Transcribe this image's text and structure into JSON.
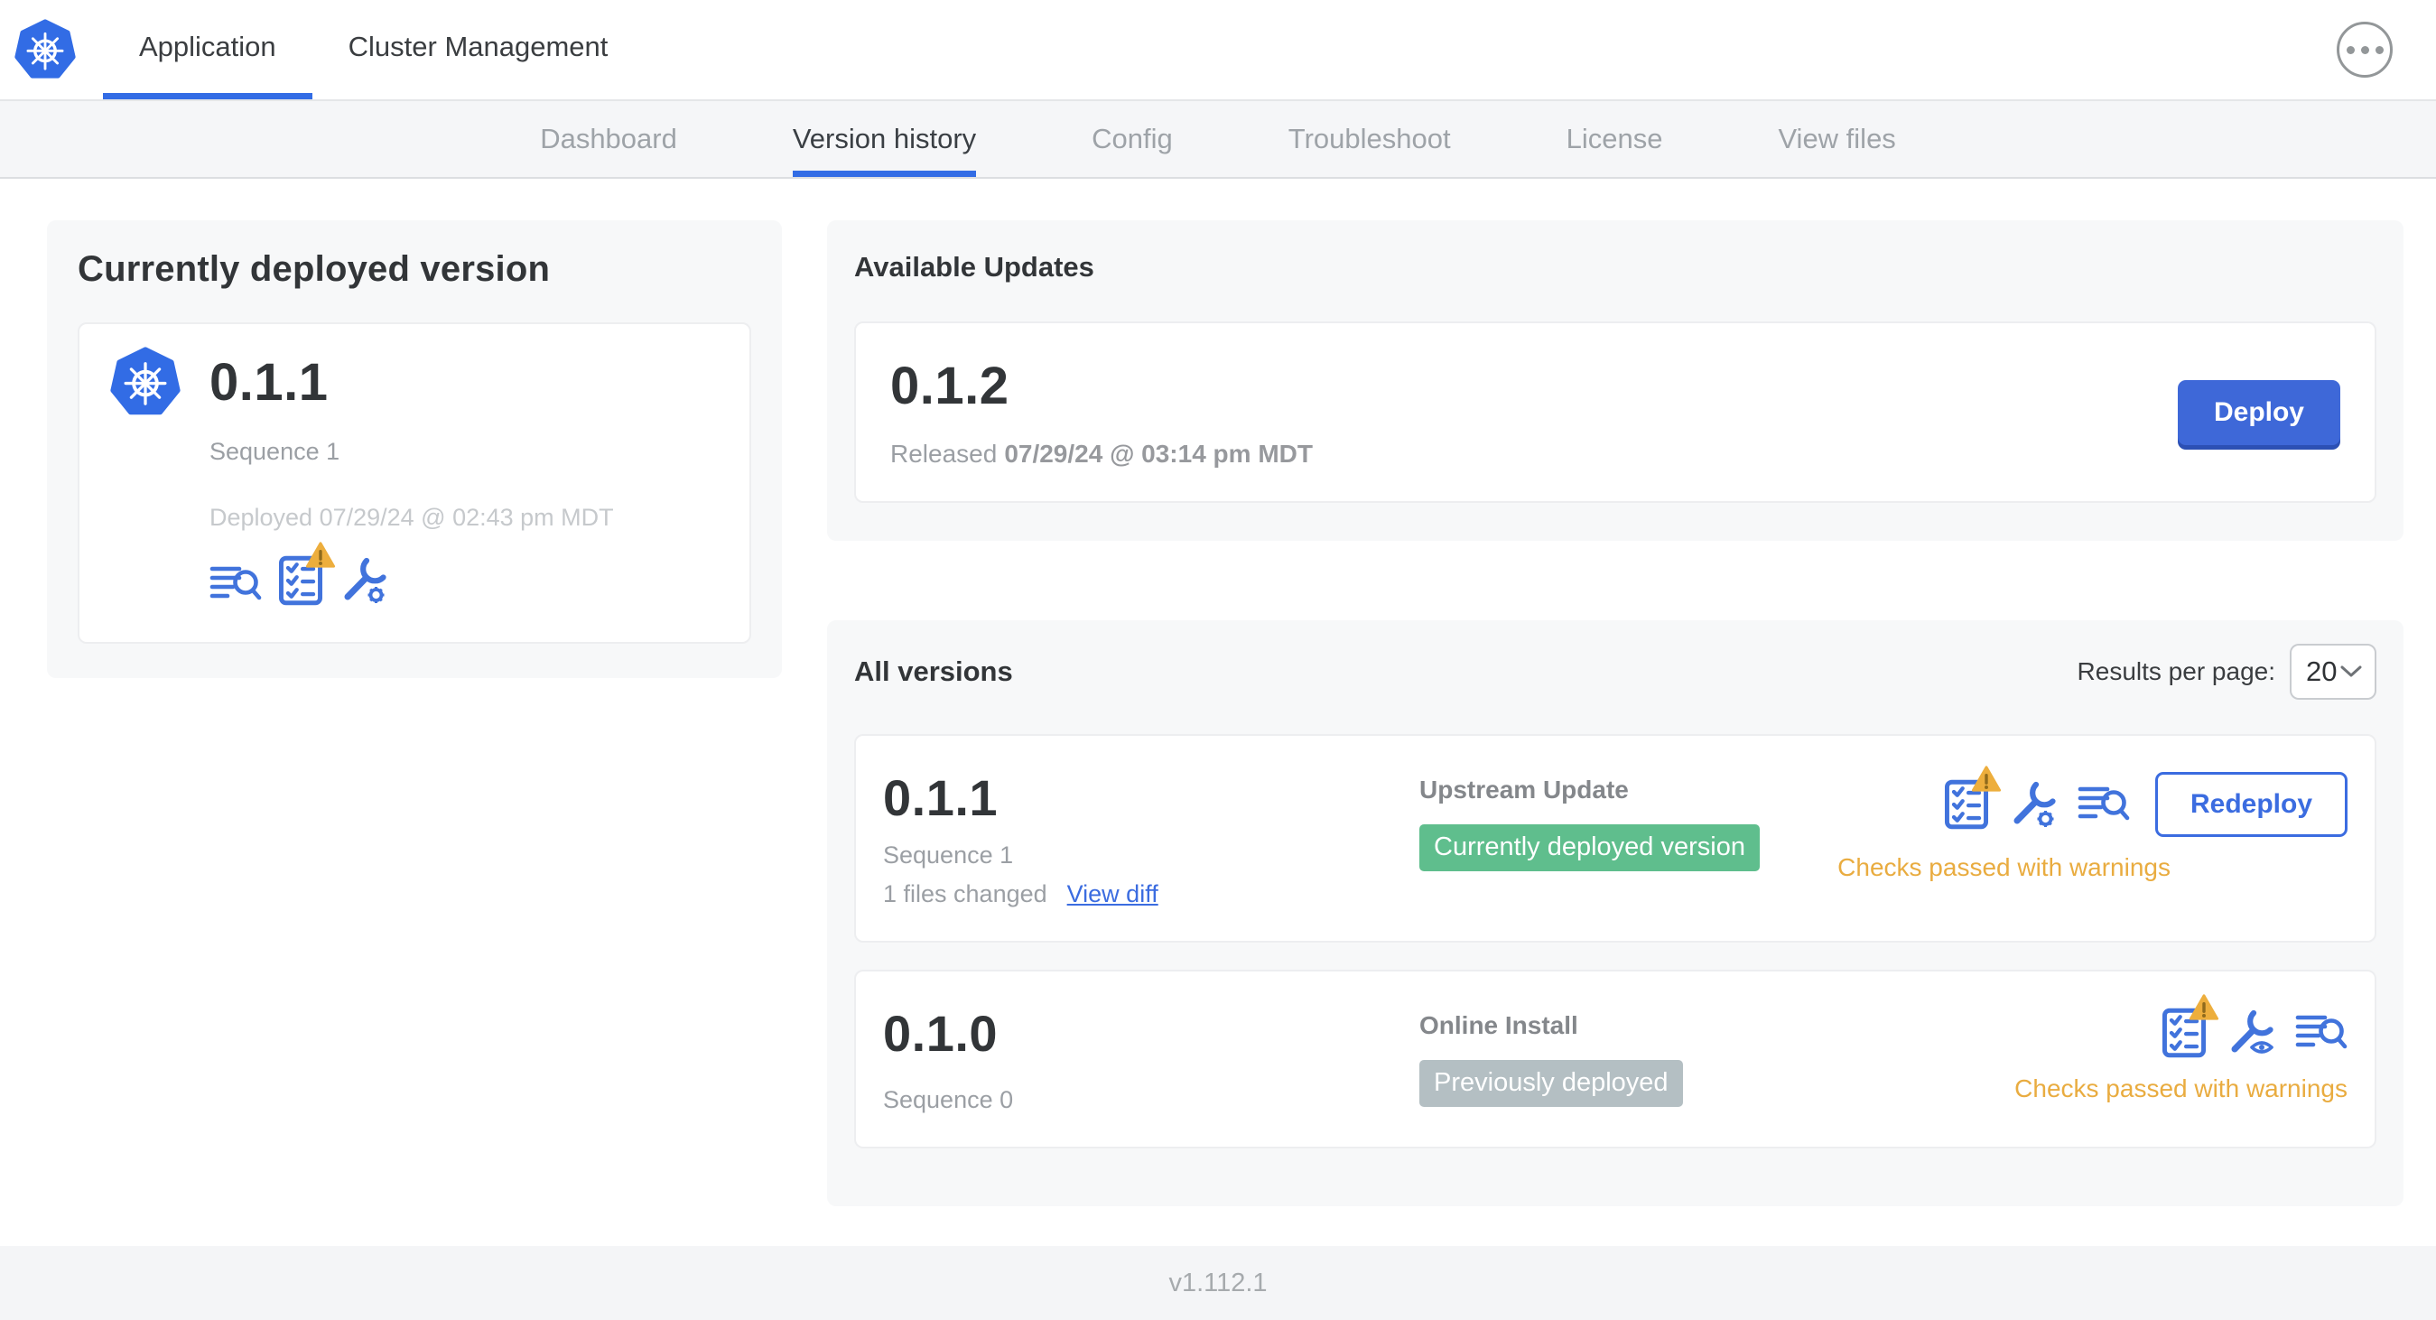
{
  "topnav": {
    "tabs": [
      {
        "label": "Application",
        "active": true
      },
      {
        "label": "Cluster Management",
        "active": false
      }
    ],
    "more_menu": "ellipsis-menu"
  },
  "subnav": {
    "tabs": [
      "Dashboard",
      "Version history",
      "Config",
      "Troubleshoot",
      "License",
      "View files"
    ],
    "active_tab": "Version history"
  },
  "current_version": {
    "title": "Currently deployed version",
    "version": "0.1.1",
    "sequence": "Sequence 1",
    "deployed": "Deployed 07/29/24 @ 02:43 pm MDT",
    "icons": [
      "release-notes-icon",
      "preflight-checks-warning-icon",
      "edit-config-icon"
    ]
  },
  "available_updates": {
    "title": "Available Updates",
    "version": "0.1.2",
    "released_label": "Released",
    "released_value": "07/29/24 @ 03:14 pm MDT",
    "deploy_label": "Deploy"
  },
  "all_versions": {
    "title": "All versions",
    "results_per_page_label": "Results per page:",
    "results_per_page_value": "20",
    "rows": [
      {
        "version": "0.1.1",
        "sequence": "Sequence 1",
        "files_changed": "1 files changed",
        "view_diff_label": "View diff",
        "source": "Upstream Update",
        "badge_label": "Currently deployed version",
        "badge_color": "#5FBE8D",
        "icons": [
          "preflight-checks-warning-icon",
          "edit-config-icon",
          "release-notes-icon"
        ],
        "action_label": "Redeploy",
        "status": "Checks passed with warnings"
      },
      {
        "version": "0.1.0",
        "sequence": "Sequence 0",
        "source": "Online Install",
        "badge_label": "Previously deployed",
        "badge_color": "#B4BFC3",
        "icons": [
          "preflight-checks-warning-icon",
          "view-config-icon",
          "release-notes-icon"
        ],
        "status": "Checks passed with warnings"
      }
    ]
  },
  "footer": {
    "version": "v1.112.1"
  },
  "colors": {
    "accent_blue": "#326CE5",
    "icon_blue": "#4173DC",
    "button_blue": "#3E68D8",
    "link_blue": "#3B6CE0",
    "badge_green": "#5FBE8D",
    "badge_gray": "#B4BFC3",
    "warning_orange": "#E9AC40"
  }
}
